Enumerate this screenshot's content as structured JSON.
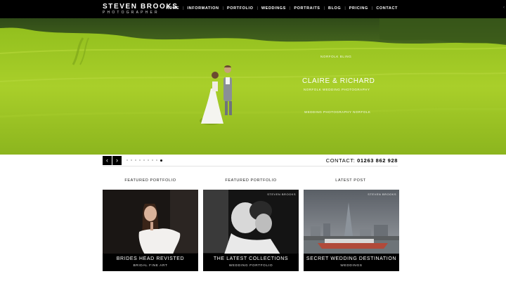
{
  "brand": {
    "name": "STEVEN BROOKS",
    "tagline": "PHOTOGRAPHER"
  },
  "nav": {
    "items": [
      "HOME",
      "INFORMATION",
      "PORTFOLIO",
      "WEDDINGS",
      "PORTRAITS",
      "BLOG",
      "PRICING",
      "CONTACT"
    ]
  },
  "hero": {
    "kicker": "NORFOLK BLING",
    "title": "CLAIRE & RICHARD",
    "subtitle": "NORFOLK WEDDING PHOTOGRAPHY",
    "footer": "WEDDING PHOTOGRAPHY NORFOLK"
  },
  "slider": {
    "prev_glyph": "‹",
    "next_glyph": "›",
    "dot_count": 9,
    "active_index": 8
  },
  "contact": {
    "label": "CONTACT:",
    "phone": "01263 862 928"
  },
  "cards": [
    {
      "heading": "FEATURED PORTFOLIO",
      "title": "BRIDES HEAD REVISTED",
      "subtitle": "BRIDAL FINE ART",
      "watermark": ""
    },
    {
      "heading": "FEATURED PORTFOLIO",
      "title": "THE LATEST COLLECTIONS",
      "subtitle": "WEDDING PORTFOLIO",
      "watermark": "STEVEN BROOKS"
    },
    {
      "heading": "LATEST POST",
      "title": "SECRET WEDDING DESTINATION",
      "subtitle": "WEDDINGS",
      "watermark": "STEVEN BROOKS"
    }
  ],
  "colors": {
    "header_bg": "#000000",
    "field_green": "#9dc524",
    "caption_bg": "#000000"
  }
}
